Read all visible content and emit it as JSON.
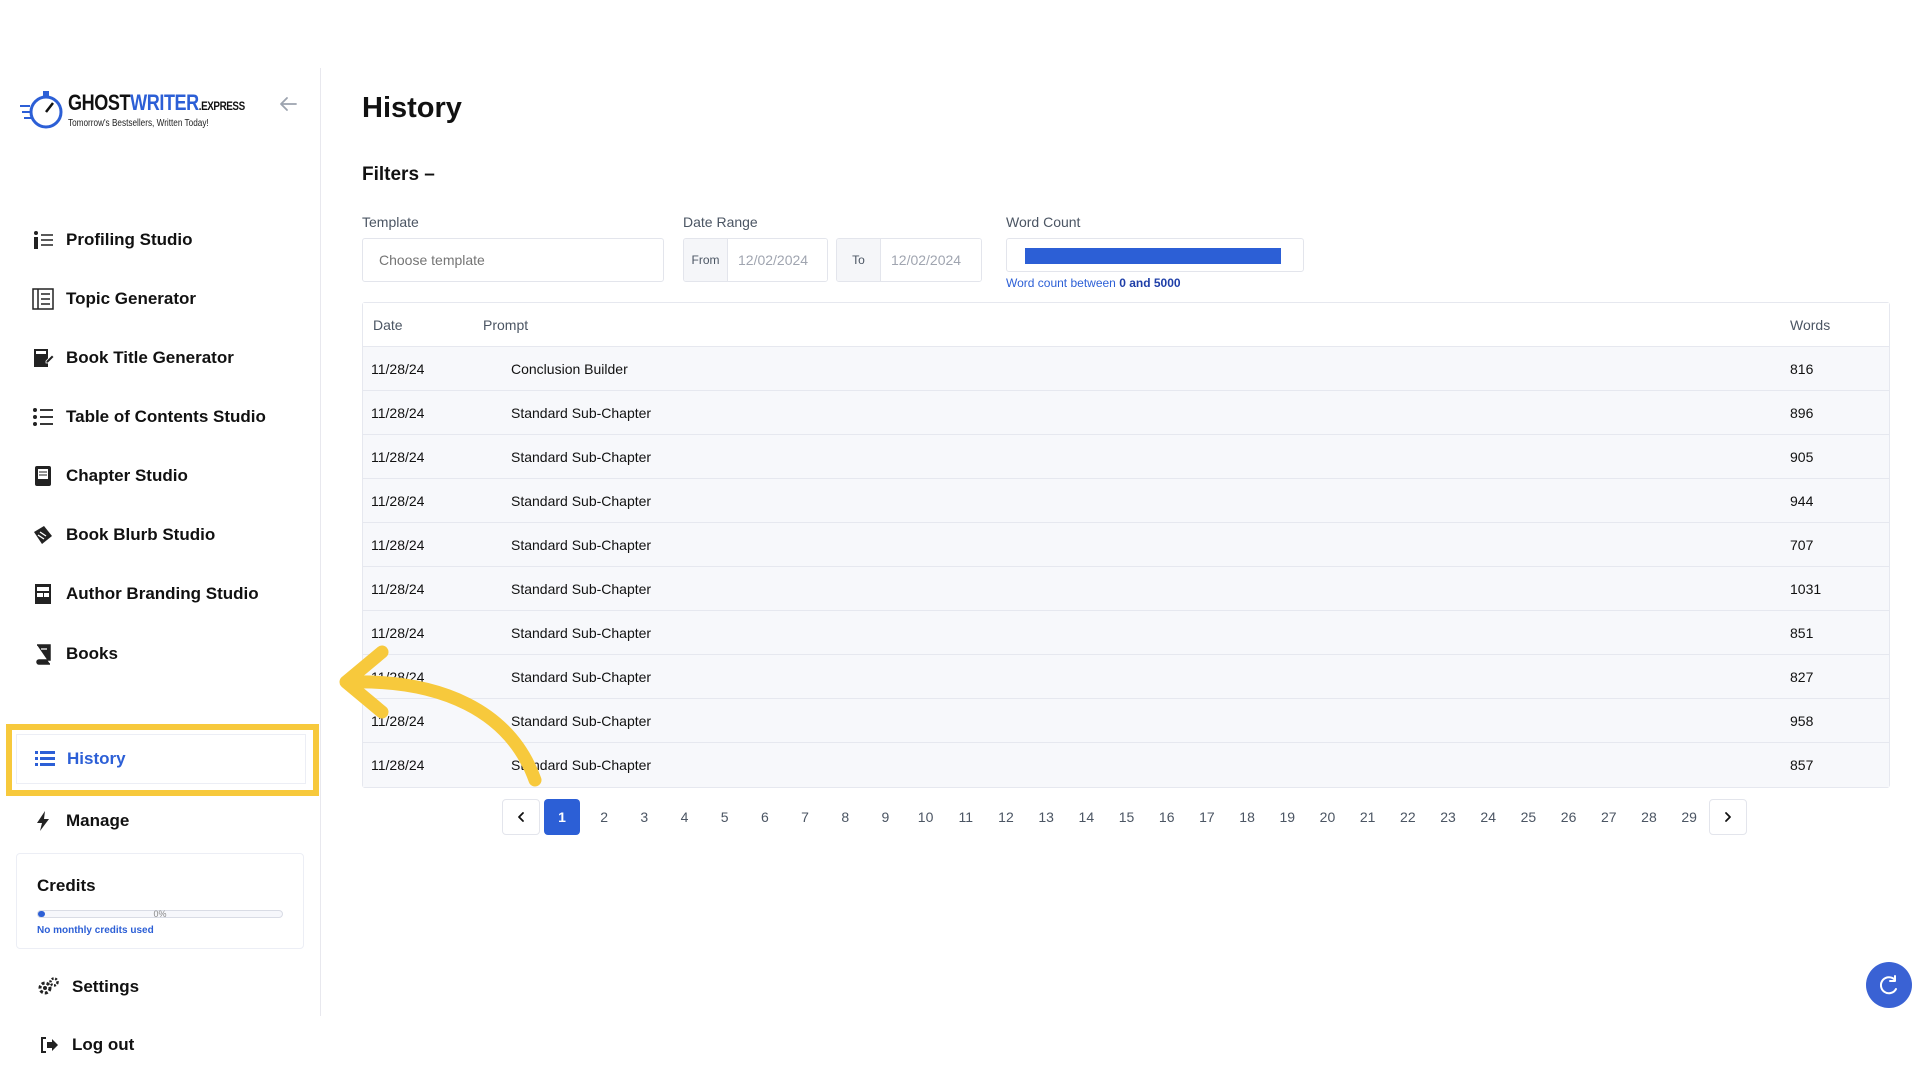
{
  "logo": {
    "main_a": "GHOST",
    "main_b": "WRITER",
    "main_c": ".EXPRESS",
    "tagline": "Tomorrow's Bestsellers, Written Today!"
  },
  "sidebar": {
    "items": [
      {
        "label": "Profiling Studio",
        "icon": "profile-list-icon"
      },
      {
        "label": "Topic Generator",
        "icon": "topic-list-icon"
      },
      {
        "label": "Book Title Generator",
        "icon": "book-edit-icon"
      },
      {
        "label": "Table of Contents Studio",
        "icon": "toc-list-icon"
      },
      {
        "label": "Chapter Studio",
        "icon": "chapter-icon"
      },
      {
        "label": "Book Blurb Studio",
        "icon": "blurb-icon"
      },
      {
        "label": "Author Branding Studio",
        "icon": "branding-icon"
      },
      {
        "label": "Books",
        "icon": "books-icon"
      }
    ],
    "history_label": "History",
    "manage_label": "Manage",
    "settings_label": "Settings",
    "logout_label": "Log out",
    "credits": {
      "title": "Credits",
      "percent_text": "0%",
      "percent_value": 0,
      "note": "No monthly credits used"
    }
  },
  "main": {
    "title": "History",
    "filters_title": "Filters –",
    "template_label": "Template",
    "template_placeholder": "Choose template",
    "date_range_label": "Date Range",
    "from_label": "From",
    "from_value": "12/02/2024",
    "to_label": "To",
    "to_value": "12/02/2024",
    "word_count_label": "Word Count",
    "word_count_hint_prefix": "Word count between ",
    "word_count_hint_range": "0 and 5000",
    "table": {
      "headers": {
        "date": "Date",
        "prompt": "Prompt",
        "words": "Words"
      },
      "rows": [
        {
          "date": "11/28/24",
          "prompt": "Conclusion Builder",
          "words": "816"
        },
        {
          "date": "11/28/24",
          "prompt": "Standard Sub-Chapter",
          "words": "896"
        },
        {
          "date": "11/28/24",
          "prompt": "Standard Sub-Chapter",
          "words": "905"
        },
        {
          "date": "11/28/24",
          "prompt": "Standard Sub-Chapter",
          "words": "944"
        },
        {
          "date": "11/28/24",
          "prompt": "Standard Sub-Chapter",
          "words": "707"
        },
        {
          "date": "11/28/24",
          "prompt": "Standard Sub-Chapter",
          "words": "1031"
        },
        {
          "date": "11/28/24",
          "prompt": "Standard Sub-Chapter",
          "words": "851"
        },
        {
          "date": "11/28/24",
          "prompt": "Standard Sub-Chapter",
          "words": "827"
        },
        {
          "date": "11/28/24",
          "prompt": "Standard Sub-Chapter",
          "words": "958"
        },
        {
          "date": "11/28/24",
          "prompt": "Standard Sub-Chapter",
          "words": "857"
        }
      ]
    },
    "pagination": {
      "current": "1",
      "pages": [
        "1",
        "2",
        "3",
        "4",
        "5",
        "6",
        "7",
        "8",
        "9",
        "10",
        "11",
        "12",
        "13",
        "14",
        "15",
        "16",
        "17",
        "18",
        "19",
        "20",
        "21",
        "22",
        "23",
        "24",
        "25",
        "26",
        "27",
        "28",
        "29"
      ]
    }
  },
  "colors": {
    "accent": "#2c5fd6",
    "highlight": "#f7c93c"
  }
}
